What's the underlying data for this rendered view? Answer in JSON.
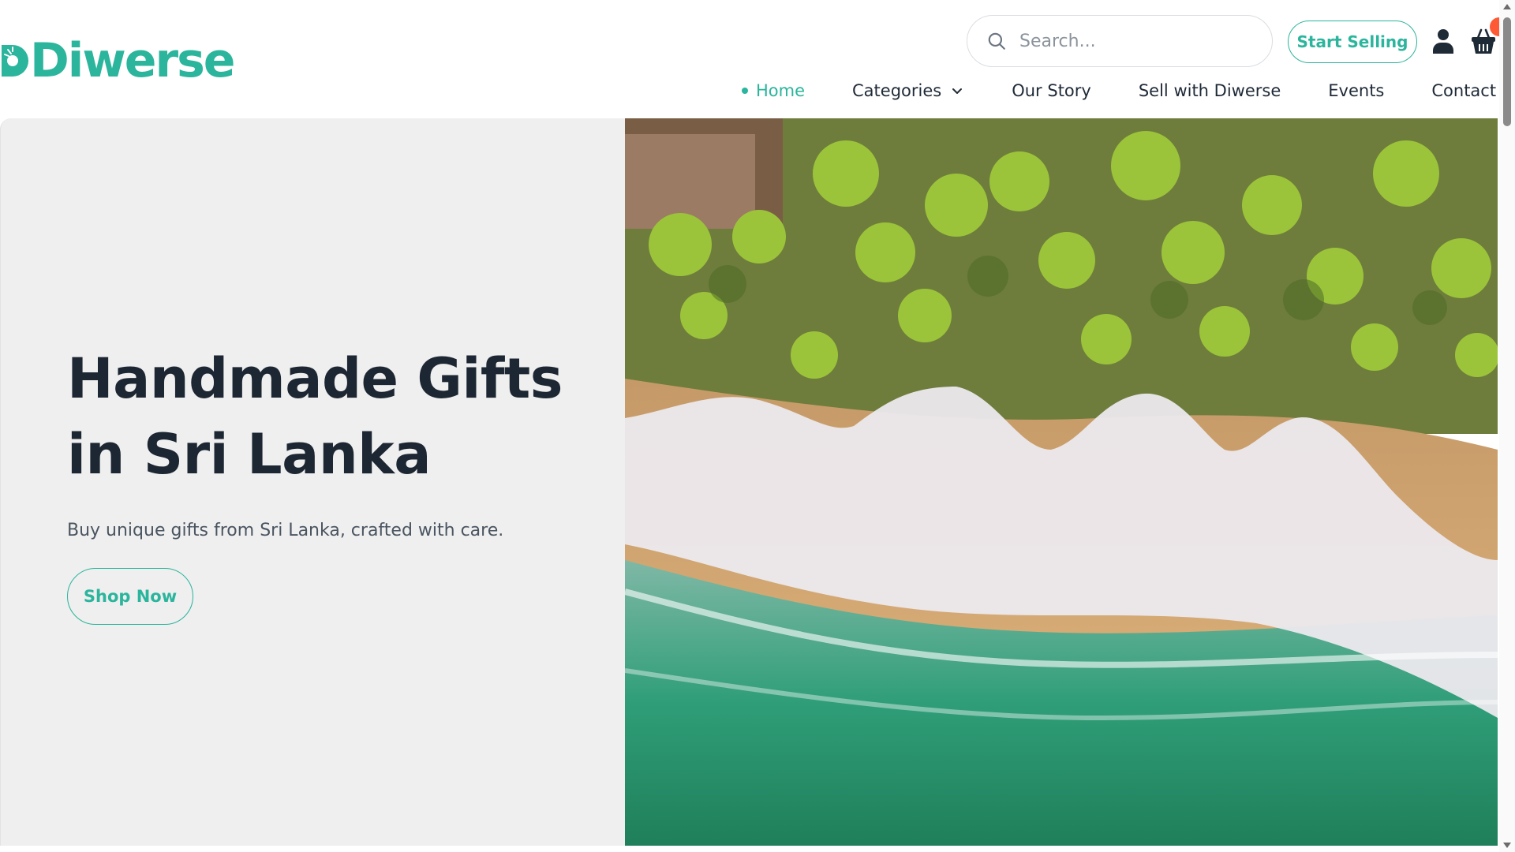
{
  "brand": {
    "name": "Diwerse",
    "accent_color": "#2bb59c"
  },
  "search": {
    "placeholder": "Search..."
  },
  "header_actions": {
    "start_selling_label": "Start Selling",
    "user_icon": "user-icon",
    "cart_icon": "shopping-basket-icon"
  },
  "nav": {
    "items": [
      {
        "label": "Home",
        "active": true
      },
      {
        "label": "Categories",
        "has_dropdown": true
      },
      {
        "label": "Our Story"
      },
      {
        "label": "Sell with Diwerse"
      },
      {
        "label": "Events"
      },
      {
        "label": "Contact Us"
      }
    ]
  },
  "hero": {
    "title": "Handmade Gifts in Sri Lanka",
    "subtitle": "Buy unique gifts from Sri Lanka, crafted with care.",
    "cta_label": "Shop Now",
    "image_subject": "aerial view of a palm-lined beach with waves"
  }
}
